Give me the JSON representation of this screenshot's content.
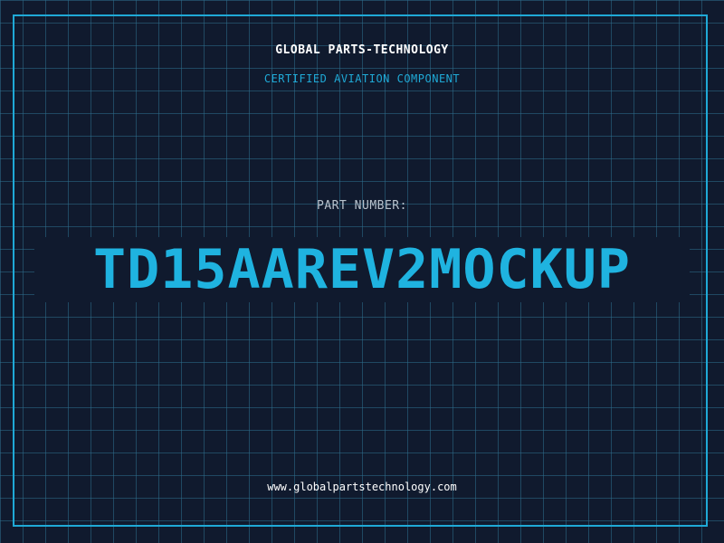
{
  "header": {
    "company": "GLOBAL PARTS-TECHNOLOGY",
    "tagline": "CERTIFIED AVIATION COMPONENT"
  },
  "part": {
    "label": "PART NUMBER:",
    "number": "TD15AAREV2MOCKUP"
  },
  "footer": {
    "website": "www.globalpartstechnology.com"
  },
  "colors": {
    "background": "#101a2e",
    "grid": "#2e6e8c",
    "accent": "#1fa9d6",
    "text": "#ffffff"
  }
}
